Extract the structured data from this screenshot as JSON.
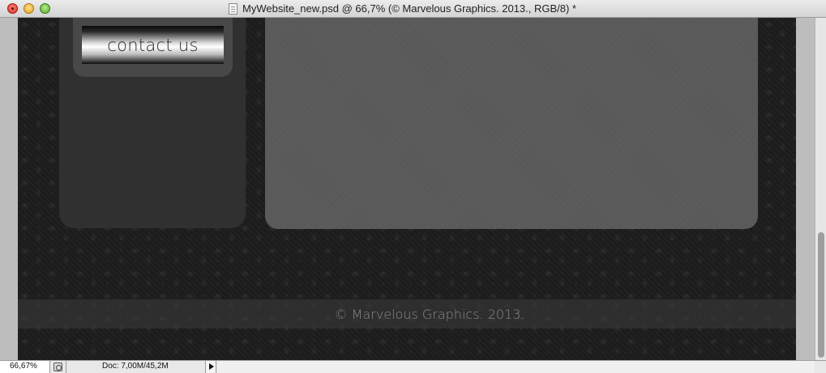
{
  "window": {
    "title": "MyWebsite_new.psd @ 66,7% (© Marvelous Graphics. 2013., RGB/8) *"
  },
  "design": {
    "nav_button_label": "contact us",
    "footer_text": "© Marvelous Graphics. 2013."
  },
  "statusbar": {
    "zoom": "66,67%",
    "doc_info": "Doc: 7,00M/45,2M"
  },
  "icons": {
    "close": "close-button",
    "minimize": "minimize-button",
    "zoom": "zoom-button",
    "document": "document-icon",
    "status_menu": "play-arrow-icon"
  }
}
